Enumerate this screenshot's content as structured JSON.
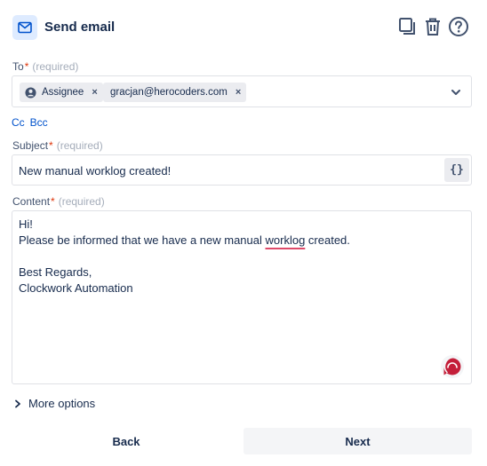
{
  "header": {
    "title": "Send email",
    "icons": [
      "mail-icon",
      "duplicate-icon",
      "trash-icon",
      "help-icon"
    ]
  },
  "to": {
    "label": "To",
    "required_mark": "*",
    "required_text": "(required)",
    "recipients": [
      {
        "label": "Assignee",
        "icon": "user-icon",
        "remove": "×"
      },
      {
        "label": "gracjan@herocoders.com",
        "remove": "×"
      }
    ]
  },
  "cc_bcc": {
    "cc": "Cc",
    "bcc": "Bcc"
  },
  "subject": {
    "label": "Subject",
    "required_mark": "*",
    "required_text": "(required)",
    "value": "New manual worklog created!",
    "insert_variable": "{}"
  },
  "content": {
    "label": "Content",
    "required_mark": "*",
    "required_text": "(required)",
    "line1": "Hi!",
    "line2_before": "Please be informed that we have a new manual ",
    "line2_flagged": "worklog",
    "line2_after": " created.",
    "line3": "Best Regards,",
    "line4": "Clockwork Automation"
  },
  "more_options": "More options",
  "footer": {
    "back": "Back",
    "next": "Next"
  },
  "colors": {
    "accent": "#0052cc",
    "required": "#de350b",
    "spell_underline": "#de4a6a",
    "grammar": "#c41f3a"
  }
}
